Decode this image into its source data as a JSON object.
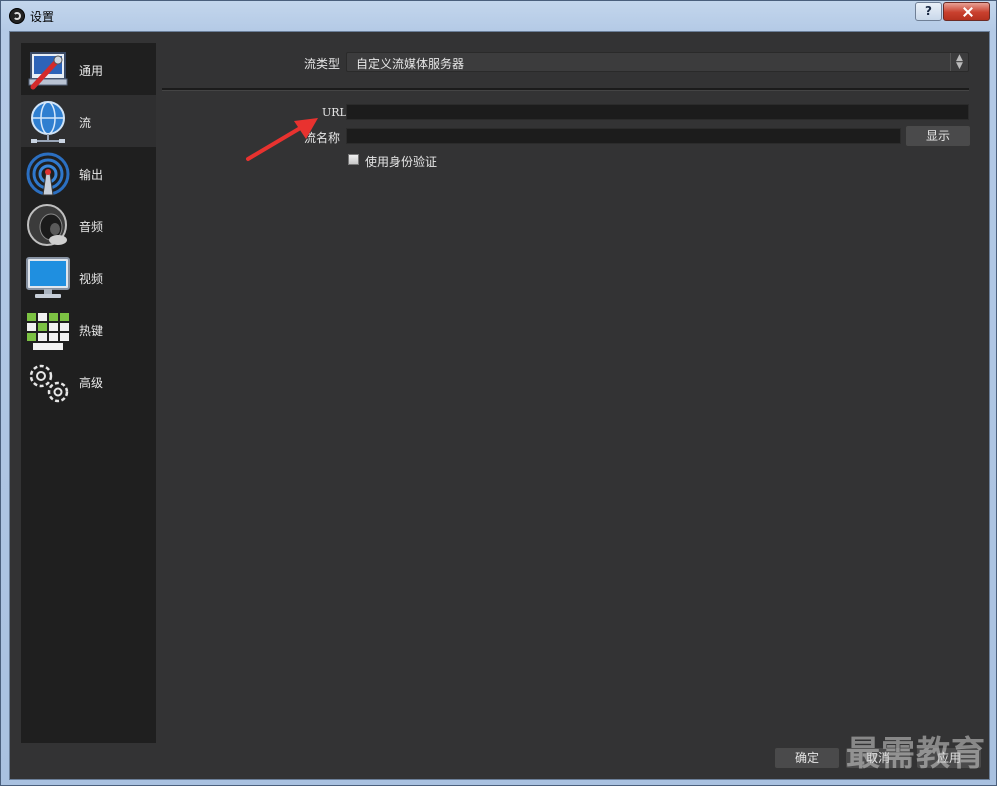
{
  "window": {
    "title": "设置",
    "help_label": "?"
  },
  "sidebar": {
    "items": [
      {
        "label": "通用",
        "icon": "general-wrench-icon"
      },
      {
        "label": "流",
        "icon": "stream-globe-icon"
      },
      {
        "label": "输出",
        "icon": "output-antenna-icon"
      },
      {
        "label": "音频",
        "icon": "audio-speaker-icon"
      },
      {
        "label": "视频",
        "icon": "video-monitor-icon"
      },
      {
        "label": "热键",
        "icon": "hotkeys-keyboard-icon"
      },
      {
        "label": "高级",
        "icon": "advanced-gears-icon"
      }
    ],
    "active_index": 1
  },
  "stream": {
    "type_label": "流类型",
    "type_value": "自定义流媒体服务器",
    "url_label": "URL",
    "url_value": "",
    "key_label": "流名称",
    "key_value": "",
    "show_label": "显示",
    "auth_label": "使用身份验证",
    "auth_checked": false
  },
  "footer": {
    "ok_label": "确定",
    "cancel_label": "取消",
    "apply_label": "应用"
  },
  "watermark": "最需教育",
  "colors": {
    "background": "#333334",
    "sidebar": "#1f1f1f",
    "active_item": "#2f2f30",
    "annotation_arrow": "#e8322f"
  }
}
